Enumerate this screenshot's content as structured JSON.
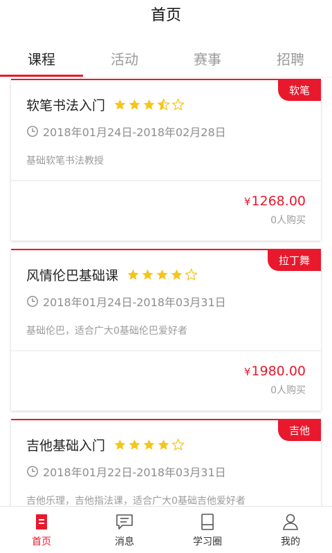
{
  "header": {
    "title": "首页"
  },
  "tabs": [
    {
      "label": "课程",
      "active": true
    },
    {
      "label": "活动",
      "active": false
    },
    {
      "label": "赛事",
      "active": false
    },
    {
      "label": "招聘",
      "active": false
    }
  ],
  "courses": [
    {
      "title": "软笔书法入门",
      "rating": 3.5,
      "tag": "软笔",
      "date_range": "2018年01月24日-2018年02月28日",
      "description": "基础软笔书法教授",
      "price_symbol": "¥",
      "price": "1268.00",
      "purchased": "0人购买"
    },
    {
      "title": "风情伦巴基础课",
      "rating": 4,
      "tag": "拉丁舞",
      "date_range": "2018年01月24日-2018年03月31日",
      "description": "基础伦巴，适合广大0基础伦巴爱好者",
      "price_symbol": "¥",
      "price": "1980.00",
      "purchased": "0人购买"
    },
    {
      "title": "吉他基础入门",
      "rating": 4,
      "tag": "吉他",
      "date_range": "2018年01月22日-2018年03月31日",
      "description": "吉他乐理，吉他指法课，适合广大0基础吉他爱好者",
      "price_symbol": "¥",
      "price": "",
      "purchased": ""
    }
  ],
  "nav": [
    {
      "label": "首页",
      "icon": "home-icon",
      "active": true
    },
    {
      "label": "消息",
      "icon": "message-icon",
      "active": false
    },
    {
      "label": "学习圈",
      "icon": "book-icon",
      "active": false
    },
    {
      "label": "我的",
      "icon": "profile-icon",
      "active": false
    }
  ],
  "colors": {
    "accent": "#e8192c",
    "star": "#f5c518",
    "muted": "#9b9b9b"
  }
}
